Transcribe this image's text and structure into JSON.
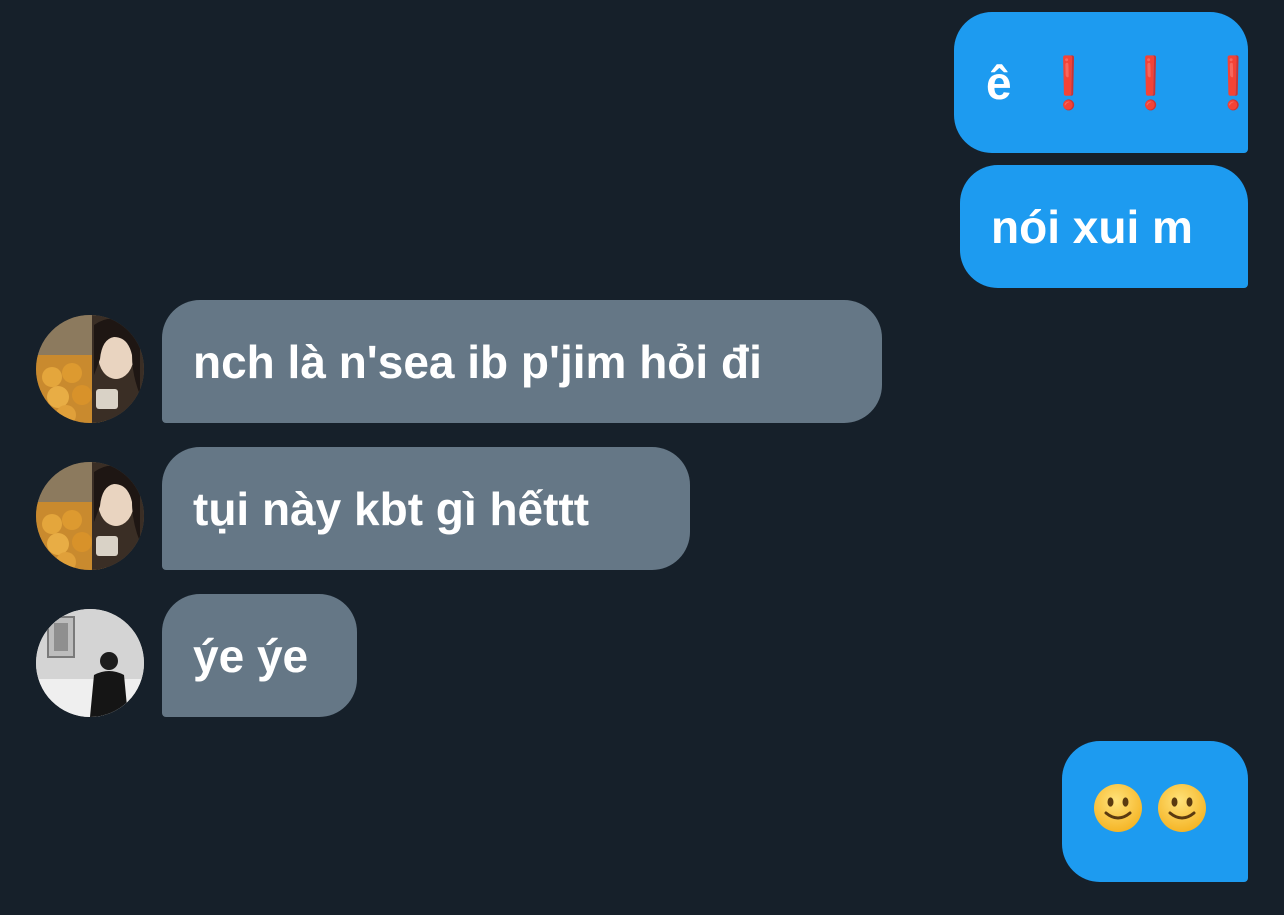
{
  "messages": [
    {
      "side": "outgoing",
      "text": "ê",
      "emphasis": [
        "❗",
        "❗",
        "❗"
      ]
    },
    {
      "side": "outgoing",
      "text": "nói xui m"
    },
    {
      "side": "incoming",
      "text": "nch là n'sea ib p'jim hỏi đi",
      "avatar": "user-a-avatar"
    },
    {
      "side": "incoming",
      "text": "tụi này kbt gì hếttt",
      "avatar": "user-a-avatar"
    },
    {
      "side": "incoming",
      "text": "ýe ýe",
      "avatar": "user-b-avatar"
    },
    {
      "side": "outgoing",
      "emoji": [
        "slightly-smiling-face-icon",
        "slightly-smiling-face-icon"
      ]
    }
  ],
  "colors": {
    "background": "#16202a",
    "outgoing_bubble": "#1d9bf0",
    "incoming_bubble": "#657786",
    "exclamation": "#e0101a"
  }
}
